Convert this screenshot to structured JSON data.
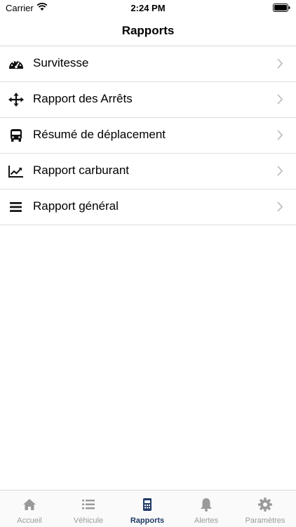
{
  "status_bar": {
    "carrier": "Carrier",
    "time": "2:24 PM"
  },
  "nav": {
    "title": "Rapports"
  },
  "list": {
    "items": [
      {
        "label": "Survitesse",
        "icon": "speedometer-icon"
      },
      {
        "label": "Rapport des Arrêts",
        "icon": "move-arrows-icon"
      },
      {
        "label": "Résumé de déplacement",
        "icon": "bus-icon"
      },
      {
        "label": "Rapport carburant",
        "icon": "line-chart-icon"
      },
      {
        "label": "Rapport général",
        "icon": "menu-lines-icon"
      }
    ]
  },
  "tabs": [
    {
      "label": "Accueil",
      "icon": "home-icon"
    },
    {
      "label": "Véhicule",
      "icon": "list-icon"
    },
    {
      "label": "Rapports",
      "icon": "report-icon",
      "active": true
    },
    {
      "label": "Alertes",
      "icon": "bell-icon"
    },
    {
      "label": "Paramètres",
      "icon": "gear-icon"
    }
  ],
  "colors": {
    "active_tab": "#1f3a66",
    "inactive_tab": "#9a9a9a",
    "chevron": "#c4c4c4"
  }
}
